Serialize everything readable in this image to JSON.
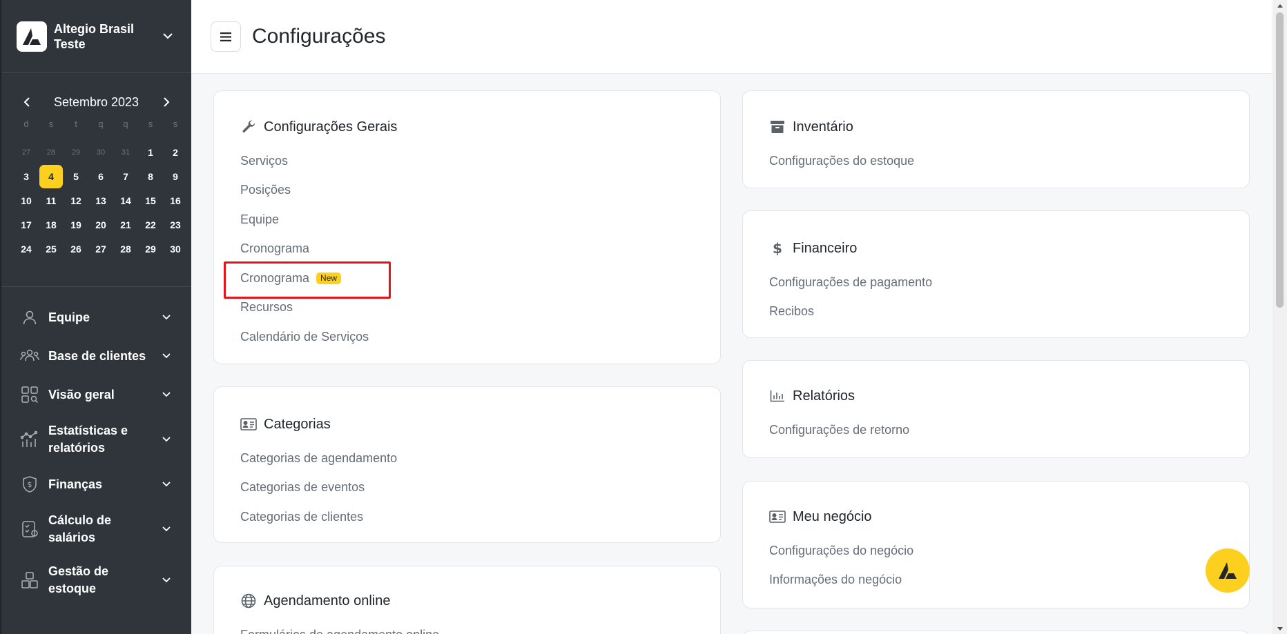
{
  "brand": {
    "name": "Altegio Brasil Teste"
  },
  "calendar": {
    "month": "Setembro 2023",
    "weekdays": [
      "d",
      "s",
      "t",
      "q",
      "q",
      "s",
      "s"
    ],
    "days": [
      {
        "d": "27",
        "m": true
      },
      {
        "d": "28",
        "m": true
      },
      {
        "d": "29",
        "m": true
      },
      {
        "d": "30",
        "m": true
      },
      {
        "d": "31",
        "m": true
      },
      {
        "d": "1"
      },
      {
        "d": "2"
      },
      {
        "d": "3"
      },
      {
        "d": "4",
        "today": true
      },
      {
        "d": "5"
      },
      {
        "d": "6"
      },
      {
        "d": "7"
      },
      {
        "d": "8"
      },
      {
        "d": "9"
      },
      {
        "d": "10"
      },
      {
        "d": "11"
      },
      {
        "d": "12"
      },
      {
        "d": "13"
      },
      {
        "d": "14"
      },
      {
        "d": "15"
      },
      {
        "d": "16"
      },
      {
        "d": "17"
      },
      {
        "d": "18"
      },
      {
        "d": "19"
      },
      {
        "d": "20"
      },
      {
        "d": "21"
      },
      {
        "d": "22"
      },
      {
        "d": "23"
      },
      {
        "d": "24"
      },
      {
        "d": "25"
      },
      {
        "d": "26"
      },
      {
        "d": "27"
      },
      {
        "d": "28"
      },
      {
        "d": "29"
      },
      {
        "d": "30"
      }
    ]
  },
  "nav": {
    "items": [
      {
        "label": "Equipe",
        "icon": "user-icon"
      },
      {
        "label": "Base de clientes",
        "icon": "clients-icon"
      },
      {
        "label": "Visão geral",
        "icon": "overview-icon"
      },
      {
        "label": "Estatísticas e relatórios",
        "icon": "stats-icon"
      },
      {
        "label": "Finanças",
        "icon": "finance-icon"
      },
      {
        "label": "Cálculo de salários",
        "icon": "salary-icon"
      },
      {
        "label": "Gestão de estoque",
        "icon": "stock-icon"
      }
    ]
  },
  "header": {
    "title": "Configurações"
  },
  "cards": {
    "geral": {
      "title": "Configurações Gerais",
      "links": [
        "Serviços",
        "Posições",
        "Equipe",
        "Cronograma",
        "Cronograma",
        "Recursos",
        "Calendário de Serviços"
      ],
      "badge": "New"
    },
    "categorias": {
      "title": "Categorias",
      "links": [
        "Categorias de agendamento",
        "Categorias de eventos",
        "Categorias de clientes"
      ]
    },
    "agendamento": {
      "title": "Agendamento online",
      "links": [
        "Formulários de agendamento online"
      ]
    },
    "inventario": {
      "title": "Inventário",
      "links": [
        "Configurações do estoque"
      ]
    },
    "financeiro": {
      "title": "Financeiro",
      "links": [
        "Configurações de pagamento",
        "Recibos"
      ]
    },
    "relatorios": {
      "title": "Relatórios",
      "links": [
        "Configurações de retorno"
      ]
    },
    "negocio": {
      "title": "Meu negócio",
      "links": [
        "Configurações do negócio",
        "Informações do negócio"
      ]
    }
  },
  "colors": {
    "accent": "#fdd01f",
    "sidebar": "#2f353b",
    "highlight": "#e3131b"
  }
}
